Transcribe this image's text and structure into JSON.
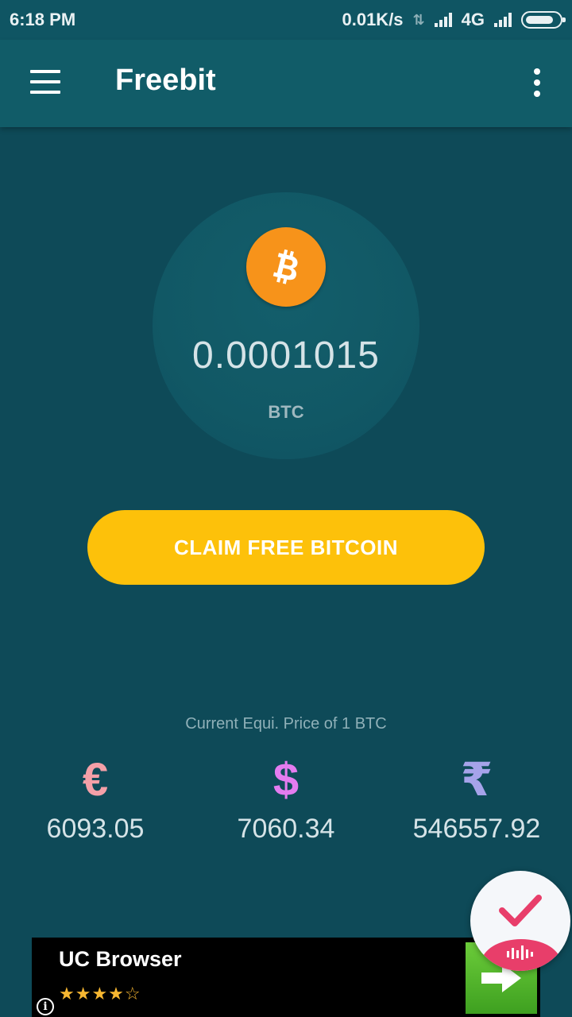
{
  "status_bar": {
    "time": "6:18 PM",
    "net_speed": "0.01K/s",
    "network_type": "4G",
    "battery_level": 0.85
  },
  "app_bar": {
    "title": "Freebit",
    "menu_icon": "hamburger-menu-icon",
    "overflow_icon": "more-vert-icon"
  },
  "balance": {
    "icon": "bitcoin-icon",
    "value": "0.0001015",
    "unit": "BTC"
  },
  "claim_button": {
    "label": "CLAIM FREE BITCOIN"
  },
  "prices": {
    "caption": "Current Equi. Price of 1 BTC",
    "items": [
      {
        "symbol": "€",
        "value": "6093.05",
        "color": "#f4a0a8"
      },
      {
        "symbol": "$",
        "value": "7060.34",
        "color": "#e47cf0"
      },
      {
        "symbol": "₹",
        "value": "546557.92",
        "color": "#a6a3ea"
      }
    ]
  },
  "ad": {
    "title": "UC Browser",
    "rating": "★★★★☆",
    "rating_value": 4,
    "info_icon": "i",
    "cta_icon": "arrow-right-icon"
  },
  "floating_badge": {
    "icon": "checkmark-icon",
    "sub_icon": "audio-wave-icon"
  },
  "colors": {
    "background": "#0e4a58",
    "app_bar": "#115c68",
    "accent": "#fdc10a",
    "bitcoin": "#f7931a"
  }
}
